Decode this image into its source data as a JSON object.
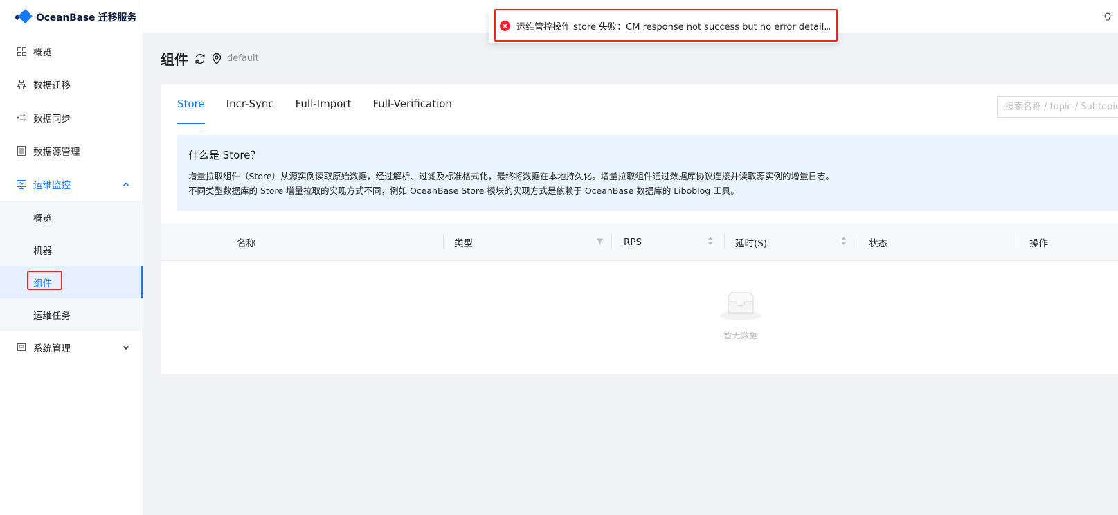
{
  "brand": {
    "name": "OceanBase 迁移服务"
  },
  "sidebar": {
    "items": [
      {
        "label": "概览",
        "icon": "dashboard-icon"
      },
      {
        "label": "数据迁移",
        "icon": "migration-icon"
      },
      {
        "label": "数据同步",
        "icon": "sync-icon"
      },
      {
        "label": "数据源管理",
        "icon": "datasource-icon"
      },
      {
        "label": "运维监控",
        "icon": "monitor-icon",
        "expanded": true
      },
      {
        "label": "系统管理",
        "icon": "system-icon",
        "expanded": false
      }
    ],
    "ops_submenu": [
      {
        "label": "概览"
      },
      {
        "label": "机器"
      },
      {
        "label": "组件",
        "active": true
      },
      {
        "label": "运维任务"
      }
    ]
  },
  "page": {
    "title": "组件",
    "env": "default"
  },
  "tabs": [
    {
      "label": "Store",
      "active": true
    },
    {
      "label": "Incr-Sync"
    },
    {
      "label": "Full-Import"
    },
    {
      "label": "Full-Verification"
    }
  ],
  "search": {
    "placeholder": "搜索名称 / topic / Subtopic"
  },
  "info": {
    "title": "什么是 Store？",
    "line1": "增量拉取组件（Store）从源实例读取原始数据，经过解析、过滤及标准格式化，最终将数据在本地持久化。增量拉取组件通过数据库协议连接并读取源实例的增量日志。",
    "line2": "不同类型数据库的 Store 增量拉取的实现方式不同，例如 OceanBase Store 模块的实现方式是依赖于 OceanBase 数据库的 Liboblog 工具。"
  },
  "table": {
    "columns": [
      "名称",
      "类型",
      "RPS",
      "延时(S)",
      "状态",
      "操作"
    ],
    "rows": [],
    "empty_text": "暂无数据"
  },
  "toast": {
    "type": "error",
    "message": "运维管控操作 store 失败：CM response not success but no error detail.。"
  },
  "colors": {
    "primary": "#1677ff",
    "error": "#f5222d",
    "highlight": "#e8271f"
  }
}
